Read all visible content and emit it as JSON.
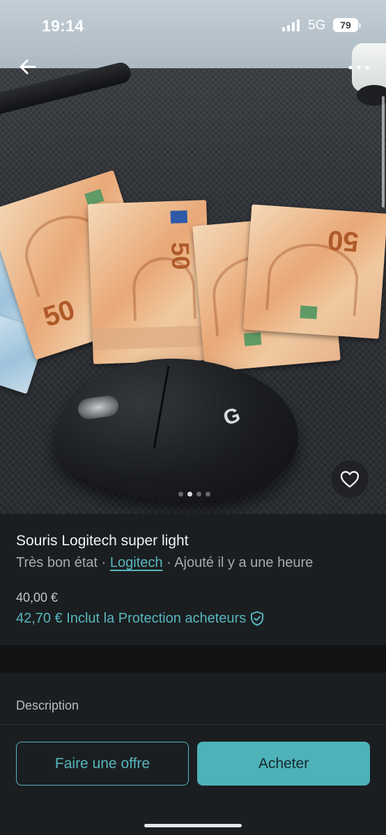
{
  "status_bar": {
    "time": "19:14",
    "network": "5G",
    "battery": "79"
  },
  "photo": {
    "alt": "Souris Logitech noire posée sur des billets de 50 euros",
    "note_values": [
      "50",
      "50",
      "50",
      "50"
    ],
    "gallery_count": 4,
    "gallery_active_index": 1
  },
  "nav": {
    "back_icon": "arrow-left-icon",
    "more_icon": "more-horizontal-icon",
    "favorite_icon": "heart-icon"
  },
  "item": {
    "title": "Souris Logitech super light",
    "condition": "Très bon état",
    "separator": "·",
    "brand": "Logitech",
    "added": "Ajouté il y a une heure",
    "price": "40,00 €",
    "price_with_protection": "42,70 € Inclut la Protection acheteurs",
    "protection_icon": "shield-check-icon"
  },
  "description": {
    "label": "Description"
  },
  "actions": {
    "offer_label": "Faire une offre",
    "buy_label": "Acheter"
  },
  "colors": {
    "accent": "#57b7bf",
    "button_primary": "#4eb2ba",
    "background": "#1b1e20"
  }
}
